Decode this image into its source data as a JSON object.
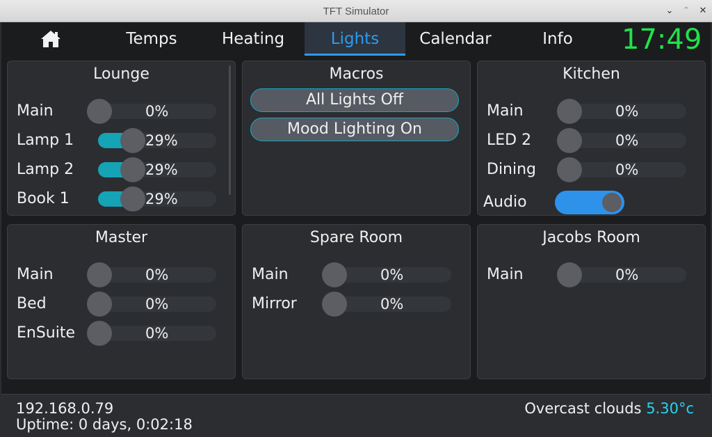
{
  "window": {
    "title": "TFT Simulator"
  },
  "nav": {
    "home_icon": "home-icon",
    "tabs": [
      {
        "label": "Temps"
      },
      {
        "label": "Heating"
      },
      {
        "label": "Lights",
        "active": true
      },
      {
        "label": "Calendar"
      },
      {
        "label": "Info"
      }
    ],
    "clock": "17:49"
  },
  "panels": {
    "lounge": {
      "title": "Lounge",
      "rows": [
        {
          "label": "Main",
          "value": "0%",
          "level": 0
        },
        {
          "label": "Lamp 1",
          "value": "29%",
          "level": 29
        },
        {
          "label": "Lamp 2",
          "value": "29%",
          "level": 29
        },
        {
          "label": "Book 1",
          "value": "29%",
          "level": 29
        }
      ]
    },
    "macros": {
      "title": "Macros",
      "buttons": [
        {
          "label": "All Lights Off"
        },
        {
          "label": "Mood Lighting On"
        }
      ]
    },
    "kitchen": {
      "title": "Kitchen",
      "rows": [
        {
          "label": "Main",
          "value": "0%",
          "level": 0
        },
        {
          "label": "LED 2",
          "value": "0%",
          "level": 0
        },
        {
          "label": "Dining",
          "value": "0%",
          "level": 0
        }
      ],
      "audio": {
        "label": "Audio",
        "on": true
      }
    },
    "master": {
      "title": "Master",
      "rows": [
        {
          "label": "Main",
          "value": "0%",
          "level": 0
        },
        {
          "label": "Bed",
          "value": "0%",
          "level": 0
        },
        {
          "label": "EnSuite",
          "value": "0%",
          "level": 0
        }
      ]
    },
    "spare_room": {
      "title": "Spare Room",
      "rows": [
        {
          "label": "Main",
          "value": "0%",
          "level": 0
        },
        {
          "label": "Mirror",
          "value": "0%",
          "level": 0
        }
      ]
    },
    "jacobs_room": {
      "title": "Jacobs Room",
      "rows": [
        {
          "label": "Main",
          "value": "0%",
          "level": 0
        }
      ]
    }
  },
  "status": {
    "ip": "192.168.0.79",
    "uptime": "Uptime: 0 days, 0:02:18",
    "weather": "Overcast clouds",
    "temperature": "5.30°c"
  },
  "colors": {
    "accent": "#2e9bef",
    "clock": "#22e24a",
    "slider_fill": "#15a3b6",
    "temperature": "#27d3f0"
  }
}
